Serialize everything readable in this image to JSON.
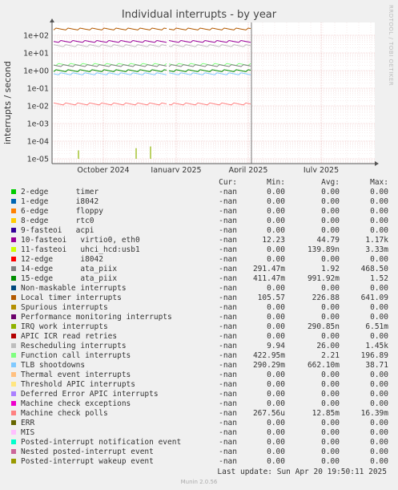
{
  "chart_data": {
    "type": "line",
    "title": "Individual interrupts - by year",
    "ylabel": "interrupts / second",
    "y_scale": "log",
    "y_ticks": [
      "1e+02",
      "1e+01",
      "1e+00",
      "1e-01",
      "1e-02",
      "1e-03",
      "1e-04",
      "1e-05"
    ],
    "x_ticks": [
      "October 2024",
      "January 2025",
      "April 2025",
      "July 2025"
    ],
    "watermark": "RRDTOOL / TOBI OETIKER",
    "columns": [
      "Cur:",
      "Min:",
      "Avg:",
      "Max:"
    ],
    "series": [
      {
        "name": "2-edge      timer",
        "color": "#00cc00",
        "cur": "-nan",
        "min": "0.00",
        "avg": "0.00",
        "max": "0.00"
      },
      {
        "name": "1-edge      i8042",
        "color": "#0066b3",
        "cur": "-nan",
        "min": "0.00",
        "avg": "0.00",
        "max": "0.00"
      },
      {
        "name": "6-edge      floppy",
        "color": "#ff8000",
        "cur": "-nan",
        "min": "0.00",
        "avg": "0.00",
        "max": "0.00"
      },
      {
        "name": "8-edge      rtc0",
        "color": "#ffcc00",
        "cur": "-nan",
        "min": "0.00",
        "avg": "0.00",
        "max": "0.00"
      },
      {
        "name": "9-fasteoi   acpi",
        "color": "#330099",
        "cur": "-nan",
        "min": "0.00",
        "avg": "0.00",
        "max": "0.00"
      },
      {
        "name": "10-fasteoi   virtio0, eth0",
        "color": "#990099",
        "cur": "-nan",
        "min": "12.23",
        "avg": "44.79",
        "max": "1.17k"
      },
      {
        "name": "11-fasteoi   uhci_hcd:usb1",
        "color": "#ccff00",
        "cur": "-nan",
        "min": "0.00",
        "avg": "139.89n",
        "max": "3.33m"
      },
      {
        "name": "12-edge      i8042",
        "color": "#ff0000",
        "cur": "-nan",
        "min": "0.00",
        "avg": "0.00",
        "max": "0.00"
      },
      {
        "name": "14-edge      ata_piix",
        "color": "#808080",
        "cur": "-nan",
        "min": "291.47m",
        "avg": "1.92",
        "max": "468.50"
      },
      {
        "name": "15-edge      ata_piix",
        "color": "#008f00",
        "cur": "-nan",
        "min": "411.47m",
        "avg": "991.92m",
        "max": "1.52"
      },
      {
        "name": "Non-maskable interrupts",
        "color": "#00487d",
        "cur": "-nan",
        "min": "0.00",
        "avg": "0.00",
        "max": "0.00"
      },
      {
        "name": "Local timer interrupts",
        "color": "#b35a00",
        "cur": "-nan",
        "min": "105.57",
        "avg": "226.88",
        "max": "641.09"
      },
      {
        "name": "Spurious interrupts",
        "color": "#b38f00",
        "cur": "-nan",
        "min": "0.00",
        "avg": "0.00",
        "max": "0.00"
      },
      {
        "name": "Performance monitoring interrupts",
        "color": "#6b006b",
        "cur": "-nan",
        "min": "0.00",
        "avg": "0.00",
        "max": "0.00"
      },
      {
        "name": "IRQ work interrupts",
        "color": "#8fb300",
        "cur": "-nan",
        "min": "0.00",
        "avg": "290.85n",
        "max": "6.51m"
      },
      {
        "name": "APIC ICR read retries",
        "color": "#b30000",
        "cur": "-nan",
        "min": "0.00",
        "avg": "0.00",
        "max": "0.00"
      },
      {
        "name": "Rescheduling interrupts",
        "color": "#bebebe",
        "cur": "-nan",
        "min": "9.94",
        "avg": "26.00",
        "max": "1.45k"
      },
      {
        "name": "Function call interrupts",
        "color": "#80ff80",
        "cur": "-nan",
        "min": "422.95m",
        "avg": "2.21",
        "max": "196.89"
      },
      {
        "name": "TLB shootdowns",
        "color": "#80c9ff",
        "cur": "-nan",
        "min": "290.29m",
        "avg": "662.10m",
        "max": "38.71"
      },
      {
        "name": "Thermal event interrupts",
        "color": "#ffc080",
        "cur": "-nan",
        "min": "0.00",
        "avg": "0.00",
        "max": "0.00"
      },
      {
        "name": "Threshold APIC interrupts",
        "color": "#ffe680",
        "cur": "-nan",
        "min": "0.00",
        "avg": "0.00",
        "max": "0.00"
      },
      {
        "name": "Deferred Error APIC interrupts",
        "color": "#aa80ff",
        "cur": "-nan",
        "min": "0.00",
        "avg": "0.00",
        "max": "0.00"
      },
      {
        "name": "Machine check exceptions",
        "color": "#ee00cc",
        "cur": "-nan",
        "min": "0.00",
        "avg": "0.00",
        "max": "0.00"
      },
      {
        "name": "Machine check polls",
        "color": "#ff8080",
        "cur": "-nan",
        "min": "267.56u",
        "avg": "12.85m",
        "max": "16.39m"
      },
      {
        "name": "ERR",
        "color": "#666600",
        "cur": "-nan",
        "min": "0.00",
        "avg": "0.00",
        "max": "0.00"
      },
      {
        "name": "MIS",
        "color": "#ffbfff",
        "cur": "-nan",
        "min": "0.00",
        "avg": "0.00",
        "max": "0.00"
      },
      {
        "name": "Posted-interrupt notification event",
        "color": "#00ffcc",
        "cur": "-nan",
        "min": "0.00",
        "avg": "0.00",
        "max": "0.00"
      },
      {
        "name": "Nested posted-interrupt event",
        "color": "#cc6699",
        "cur": "-nan",
        "min": "0.00",
        "avg": "0.00",
        "max": "0.00"
      },
      {
        "name": "Posted-interrupt wakeup event",
        "color": "#999900",
        "cur": "-nan",
        "min": "0.00",
        "avg": "0.00",
        "max": "0.00"
      }
    ],
    "plotted_levels": [
      {
        "series": "Local timer interrupts",
        "value": 226.88
      },
      {
        "series": "10-fasteoi   virtio0, eth0",
        "value": 44.79
      },
      {
        "series": "Rescheduling interrupts",
        "value": 26.0
      },
      {
        "series": "Function call interrupts",
        "value": 2.21
      },
      {
        "series": "14-edge      ata_piix",
        "value": 1.92
      },
      {
        "series": "15-edge      ata_piix",
        "value": 0.99
      },
      {
        "series": "TLB shootdowns",
        "value": 0.66
      },
      {
        "series": "Machine check polls",
        "value": 0.0128
      }
    ],
    "last_update": "Last update: Sun Apr 20 19:50:11 2025",
    "footer": "Munin 2.0.56"
  }
}
